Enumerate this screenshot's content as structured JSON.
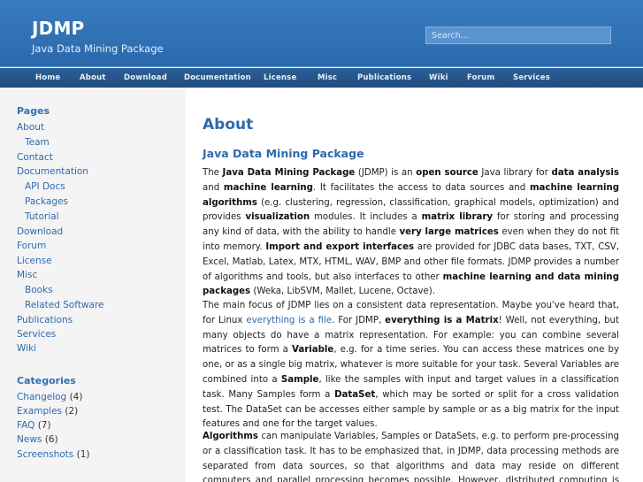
{
  "header": {
    "title": "JDMP",
    "subtitle": "Java Data Mining Package",
    "search_placeholder": "Search..."
  },
  "nav": [
    "Home",
    "About",
    "Download",
    "Documentation",
    "License",
    "Misc",
    "Publications",
    "Wiki",
    "Forum",
    "Services"
  ],
  "sidebar": {
    "pages_heading": "Pages",
    "pages": [
      {
        "label": "About"
      },
      {
        "label": "Team"
      },
      {
        "label": "Contact"
      },
      {
        "label": "Documentation"
      },
      {
        "label": "API Docs"
      },
      {
        "label": "Packages"
      },
      {
        "label": "Tutorial"
      },
      {
        "label": "Download"
      },
      {
        "label": "Forum"
      },
      {
        "label": "License"
      },
      {
        "label": "Misc"
      },
      {
        "label": "Books"
      },
      {
        "label": "Related Software"
      },
      {
        "label": "Publications"
      },
      {
        "label": "Services"
      },
      {
        "label": "Wiki"
      }
    ],
    "categories_heading": "Categories",
    "categories": [
      {
        "label": "Changelog",
        "count": "(4)"
      },
      {
        "label": "Examples",
        "count": "(2)"
      },
      {
        "label": "FAQ",
        "count": "(7)"
      },
      {
        "label": "News",
        "count": "(6)"
      },
      {
        "label": "Screenshots",
        "count": "(1)"
      }
    ]
  },
  "content": {
    "title": "About",
    "subtitle": "Java Data Mining Package",
    "para1": [
      {
        "t": "The "
      },
      {
        "b": "Java Data Mining Package"
      },
      {
        "t": " (JDMP) is an "
      },
      {
        "b": "open source"
      },
      {
        "t": " Java library for "
      },
      {
        "b": "data analysis"
      },
      {
        "t": " and "
      },
      {
        "b": "machine learning"
      },
      {
        "t": ". It facilitates the access to data sources and "
      },
      {
        "b": "machine learning algorithms"
      },
      {
        "t": " (e.g. clustering, regression, classification, graphical models, optimization) and provides "
      },
      {
        "b": "visualization"
      },
      {
        "t": " modules. It includes a "
      },
      {
        "b": "matrix library"
      },
      {
        "t": " for storing and processing any kind of data, with the ability to handle "
      },
      {
        "b": "very large matrices"
      },
      {
        "t": " even when they do not fit into memory. "
      },
      {
        "b": "Import and export interfaces"
      },
      {
        "t": " are provided for JDBC data bases, TXT, CSV, Excel, Matlab, Latex, MTX, HTML, WAV, BMP and other file formats. JDMP provides a number of algorithms and tools, but also interfaces to other "
      },
      {
        "b": "machine learning and data mining packages"
      },
      {
        "t": " (Weka, LibSVM, Mallet, Lucene, Octave)."
      }
    ],
    "para2": [
      {
        "t": "The main focus of JDMP lies on a consistent data representation. Maybe you've heard that, for Linux "
      },
      {
        "a": "everything is a file"
      },
      {
        "t": ". For JDMP, "
      },
      {
        "b": "everything is a Matrix"
      },
      {
        "t": "! Well, not everything, but many objects do have a matrix representation. For example: you can combine several matrices to form a "
      },
      {
        "b": "Variable"
      },
      {
        "t": ", e.g. for a time series. You can access these matrices one by one, or as a single big matrix, whatever is more suitable for your task. Several Variables are combined into a "
      },
      {
        "b": "Sample"
      },
      {
        "t": ", like the samples with input and target values in a classification task. Many Samples form a "
      },
      {
        "b": "DataSet"
      },
      {
        "t": ", which may be sorted or split for a cross validation test. The DataSet can be accesses either sample by sample or as a big matrix for the input features and one for the target values."
      }
    ],
    "para3": [
      {
        "b": "Algorithms"
      },
      {
        "t": " can manipulate Variables, Samples or DataSets, e.g. to perform pre-processing or a classification task. It has to be emphasized that, in JDMP, data processing methods are separated from data sources, so that algorithms and data may reside on different computers and parallel processing becomes possible. However, distributed computing is not yet fully"
      }
    ]
  },
  "colors": {
    "header_bg": "#3a7cc0",
    "nav_bg": "#2b5f97",
    "link": "#2e6aac",
    "sidebar_bg": "#f4f4f4"
  }
}
